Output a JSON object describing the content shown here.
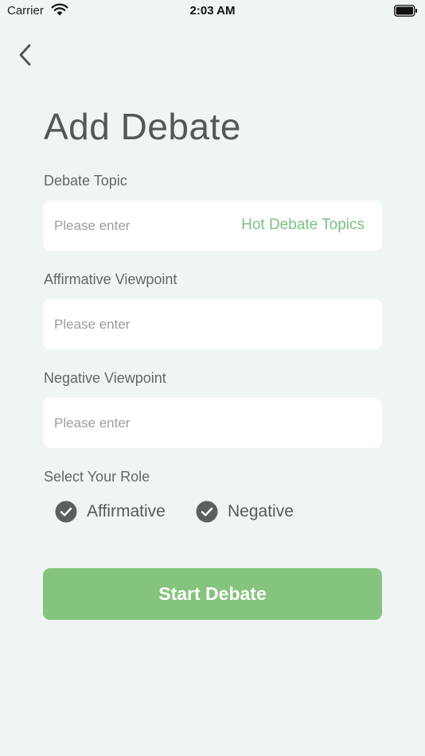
{
  "status_bar": {
    "carrier": "Carrier",
    "time": "2:03 AM"
  },
  "header": {
    "back_icon": "chevron-left-icon",
    "title": "Add Debate"
  },
  "form": {
    "topic": {
      "label": "Debate Topic",
      "placeholder": "Please enter",
      "value": "",
      "hot_topics_label": "Hot Debate Topics"
    },
    "affirmative": {
      "label": "Affirmative Viewpoint",
      "placeholder": "Please enter",
      "value": ""
    },
    "negative": {
      "label": "Negative Viewpoint",
      "placeholder": "Please enter",
      "value": ""
    },
    "role": {
      "label": "Select Your Role",
      "options": [
        {
          "label": "Affirmative",
          "checked": true
        },
        {
          "label": "Negative",
          "checked": true
        }
      ]
    },
    "submit_label": "Start Debate"
  },
  "colors": {
    "background": "#eff4f4",
    "accent_green": "#85c47d",
    "link_green": "#7cc081",
    "check_fill": "#5b5f61",
    "text": "#555a5c"
  }
}
